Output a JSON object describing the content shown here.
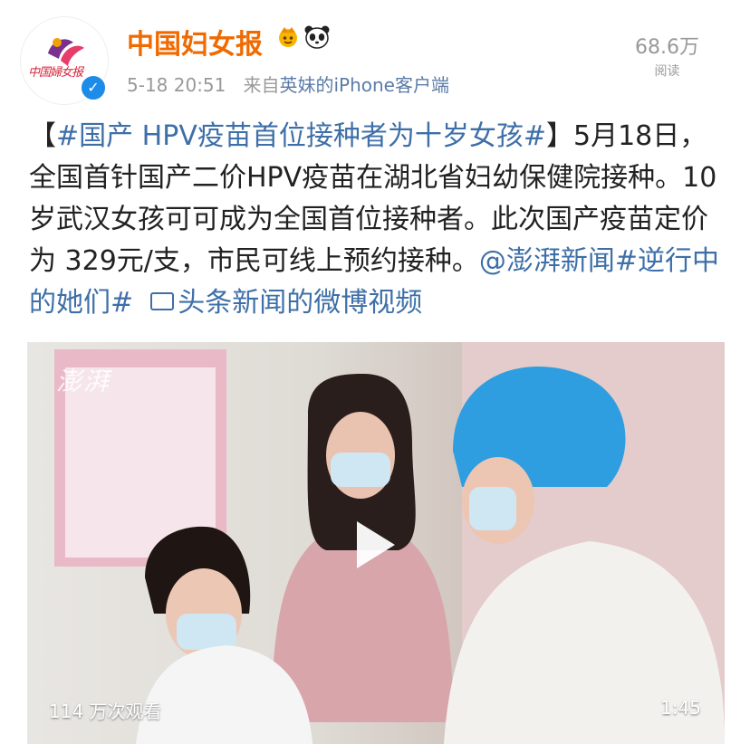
{
  "header": {
    "account_name": "中国妇女报",
    "logo_text": "中国婦女报",
    "post_time": "5-18 20:51",
    "source_prefix": "来自",
    "source_app": "英妹的iPhone客户端",
    "views_count": "68.6万",
    "views_label": "阅读",
    "badges": [
      "crown-icon",
      "panda-icon"
    ],
    "verified_mark": "✓"
  },
  "post": {
    "bracket_open": "【",
    "topic_title": "#国产 HPV疫苗首位接种者为十岁女孩#",
    "body_text": "】5月18日，全国首针国产二价HPV疫苗在湖北省妇幼保健院接种。10岁武汉女孩可可成为全国首位接种者。此次国产疫苗定价为 329元/支，市民可线上预约接种。",
    "mention": "@澎湃新闻",
    "topic2": "#逆行中的她们#",
    "video_link": "头条新闻的微博视频"
  },
  "video": {
    "watermark": "澎湃",
    "play_count": "114 万次观看",
    "duration": "1:45"
  },
  "colors": {
    "account_name": "#f06a00",
    "link": "#3e6fa8",
    "meta": "#999999",
    "verified": "#1d8be8"
  }
}
